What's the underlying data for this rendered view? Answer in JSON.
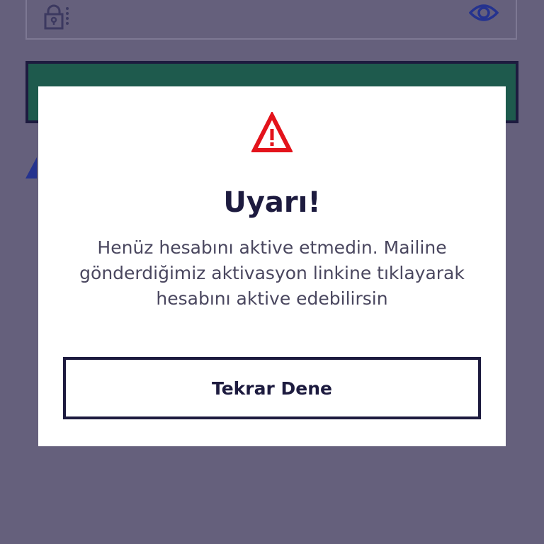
{
  "background": {
    "password_field": {
      "lock_icon": "lock-dots-icon",
      "visibility_icon": "eye-icon"
    },
    "login_button": {
      "color": "#1e5a4d"
    }
  },
  "dialog": {
    "icon": "warning-triangle-icon",
    "icon_color": "#e3131b",
    "title": "Uyarı!",
    "message": "Henüz hesabını aktive etmedin. Mailine gönderdiğimiz aktivasyon linkine tıklayarak hesabını aktive edebilirsin",
    "retry_button_label": "Tekrar Dene"
  },
  "colors": {
    "overlay": "#65607c",
    "primary_text": "#1d1b3f",
    "body_text": "#4a475f",
    "dialog_bg": "#ffffff"
  }
}
